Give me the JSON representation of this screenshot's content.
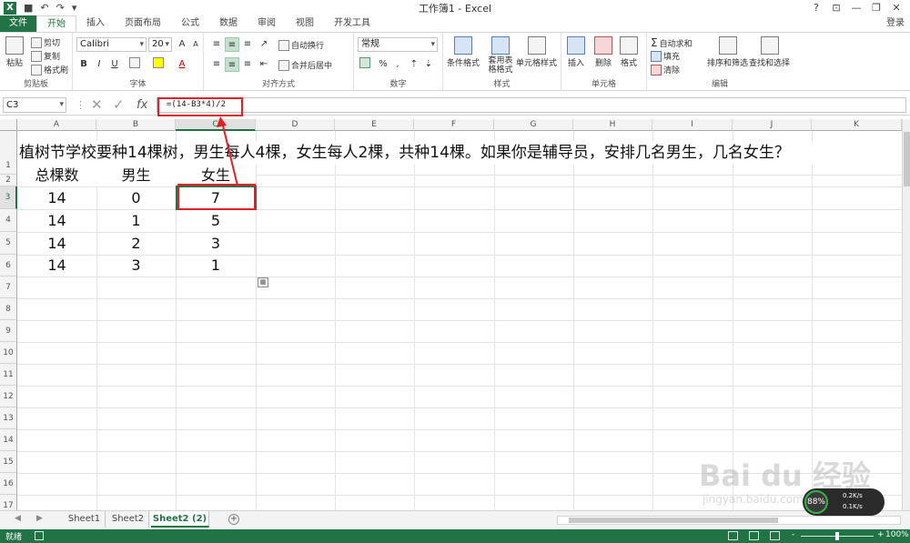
{
  "window": {
    "title": "工作簿1 - Excel",
    "help_label": "?",
    "controls": [
      "⊡",
      "—",
      "❐",
      "✕"
    ]
  },
  "ribbon_tabs": [
    "文件",
    "开始",
    "插入",
    "页面布局",
    "公式",
    "数据",
    "审阅",
    "视图",
    "开发工具"
  ],
  "login_label": "登录",
  "ribbon": {
    "clipboard": {
      "label": "剪贴板",
      "paste": "粘贴",
      "cut": "剪切",
      "copy": "复制",
      "format_painter": "格式刷"
    },
    "font": {
      "label": "字体",
      "font_name": "Calibri",
      "font_size": "20",
      "bold": "B",
      "italic": "I",
      "underline": "U",
      "grow": "A",
      "shrink": "A",
      "font_color": "A"
    },
    "alignment": {
      "label": "对齐方式",
      "wrap": "自动换行",
      "merge": "合并后居中"
    },
    "number": {
      "label": "数字",
      "format": "常规",
      "percent": "%",
      "comma": ","
    },
    "styles": {
      "label": "样式",
      "conditional": "条件格式",
      "table": "套用表格格式",
      "cell_styles": "单元格样式"
    },
    "cells": {
      "label": "单元格",
      "insert": "插入",
      "delete": "删除",
      "format": "格式"
    },
    "editing": {
      "label": "编辑",
      "autosum": "自动求和",
      "fill": "填充",
      "clear": "清除",
      "sort": "排序和筛选",
      "find": "查找和选择"
    }
  },
  "formula_bar": {
    "name_box": "C3",
    "cancel": "✕",
    "enter": "✓",
    "fx": "fx",
    "formula": "=(14-B3*4)/2"
  },
  "columns": [
    "A",
    "B",
    "C",
    "D",
    "E",
    "F",
    "G",
    "H",
    "I",
    "J",
    "K"
  ],
  "rows": [
    "1",
    "2",
    "3",
    "4",
    "5",
    "6",
    "7",
    "8",
    "9",
    "10",
    "11",
    "12",
    "13",
    "14",
    "15",
    "16",
    "17"
  ],
  "sheet": {
    "problem": "植树节学校要种14棵树，男生每人4棵，女生每人2棵，共种14棵。如果你是辅导员，安排几名男生，几名女生？",
    "headers": [
      "总棵数",
      "男生",
      "女生"
    ],
    "data": [
      [
        "14",
        "0",
        "7"
      ],
      [
        "14",
        "1",
        "5"
      ],
      [
        "14",
        "2",
        "3"
      ],
      [
        "14",
        "3",
        "1"
      ]
    ]
  },
  "sheet_tabs": [
    "Sheet1",
    "Sheet2",
    "Sheet2 (2)"
  ],
  "active_sheet": "Sheet2 (2)",
  "add_sheet": "+",
  "status": {
    "ready": "就绪",
    "zoom_minus": "-",
    "zoom_plus": "+",
    "zoom": "100%"
  },
  "speed_widget": {
    "percent": "88%",
    "up": "0.2K/s",
    "down": "0.1K/s"
  },
  "watermark": {
    "brand": "Bai du 经验",
    "url": "jingyan.baidu.com"
  },
  "colors": {
    "excel_green": "#217346",
    "annotation_red": "#e0202a"
  }
}
